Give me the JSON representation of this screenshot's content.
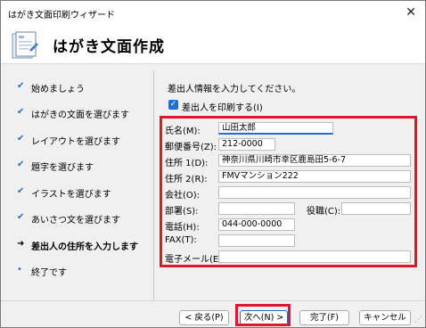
{
  "window": {
    "title": "はがき文面印刷ウィザード",
    "close_glyph": "✕"
  },
  "header": {
    "title": "はがき文面作成",
    "icon": "postcard-icon"
  },
  "steps": [
    {
      "label": "始めましょう",
      "mark": "✔"
    },
    {
      "label": "はがきの文面を選びます",
      "mark": "✔"
    },
    {
      "label": "レイアウトを選びます",
      "mark": "✔"
    },
    {
      "label": "題字を選びます",
      "mark": "✔"
    },
    {
      "label": "イラストを選びます",
      "mark": "✔"
    },
    {
      "label": "あいさつ文を選びます",
      "mark": "✔"
    },
    {
      "label": "差出人の住所を入力します",
      "mark": "➜"
    },
    {
      "label": "終了です",
      "mark": "•"
    }
  ],
  "content": {
    "prompt": "差出人情報を入力してください。",
    "print_checkbox": {
      "label": "差出人を印刷する(I)",
      "checked": true,
      "glyph": "✓"
    }
  },
  "form": {
    "name": {
      "label": "氏名(M):",
      "value": "山田太郎"
    },
    "postal": {
      "label": "郵便番号(Z):",
      "value": "212-0000"
    },
    "address1": {
      "label": "住所 1(D):",
      "value": "神奈川県川崎市幸区鹿島田5-6-7"
    },
    "address2": {
      "label": "住所 2(R):",
      "value": "FMVマンション222"
    },
    "company": {
      "label": "会社(O):",
      "value": ""
    },
    "department": {
      "label": "部署(S):",
      "value": ""
    },
    "position": {
      "label": "役職(C):",
      "value": ""
    },
    "phone": {
      "label": "電話(H):",
      "value": "044-000-0000"
    },
    "fax": {
      "label": "FAX(T):",
      "value": ""
    },
    "email": {
      "label": "電子メール(E):",
      "value": ""
    }
  },
  "buttons": {
    "back": "< 戻る(P)",
    "next": "次へ(N) >",
    "finish": "完了(F)",
    "cancel": "キャンセル"
  },
  "colors": {
    "accent": "#1f6fd1",
    "highlight": "#e0162b"
  }
}
